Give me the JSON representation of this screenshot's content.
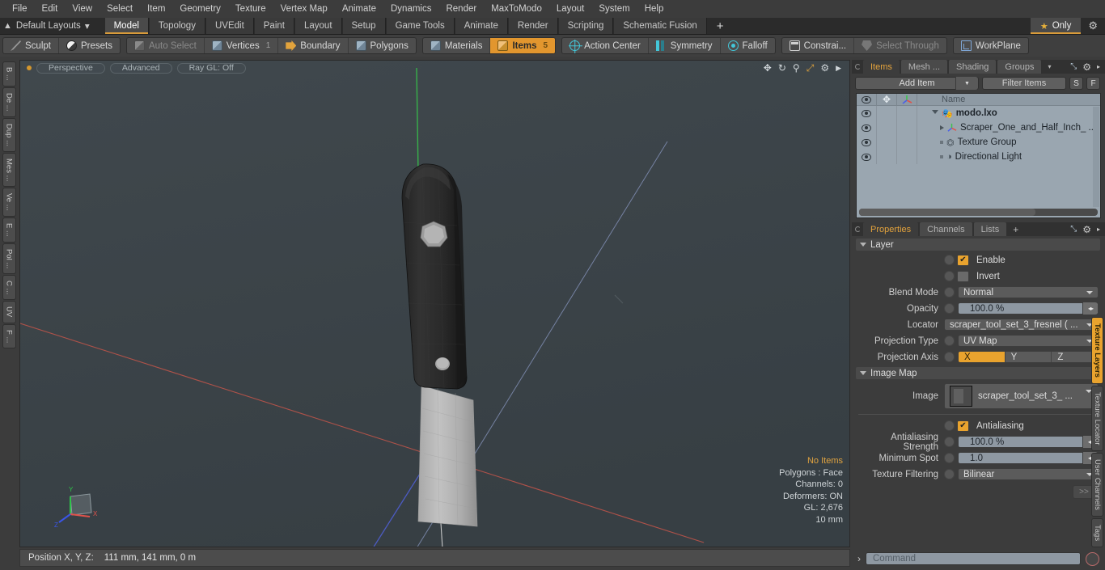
{
  "menu": {
    "items": [
      "File",
      "Edit",
      "View",
      "Select",
      "Item",
      "Geometry",
      "Texture",
      "Vertex Map",
      "Animate",
      "Dynamics",
      "Render",
      "MaxToModo",
      "Layout",
      "System",
      "Help"
    ]
  },
  "layout_bar": {
    "preset_label": "Default Layouts",
    "preset_caret": "▾",
    "tabs": [
      {
        "label": "Model",
        "active": true
      },
      {
        "label": "Topology",
        "active": false
      },
      {
        "label": "UVEdit",
        "active": false
      },
      {
        "label": "Paint",
        "active": false
      },
      {
        "label": "Layout",
        "active": false
      },
      {
        "label": "Setup",
        "active": false
      },
      {
        "label": "Game Tools",
        "active": false
      },
      {
        "label": "Animate",
        "active": false
      },
      {
        "label": "Render",
        "active": false
      },
      {
        "label": "Scripting",
        "active": false
      },
      {
        "label": "Schematic Fusion",
        "active": false
      }
    ],
    "add_tab": "+",
    "only_label": "Only",
    "star_icon": "★",
    "gear_icon": "⚙",
    "accent": "#d89b3a"
  },
  "toolbar": {
    "group1": [
      {
        "label": "Sculpt",
        "icon": "pencil-icon"
      },
      {
        "label": "Presets",
        "icon": "sphere-icon"
      }
    ],
    "group2": [
      {
        "label": "Auto Select",
        "icon": "cube-gray-icon",
        "count": "",
        "dim": true,
        "on": false
      },
      {
        "label": "Vertices",
        "icon": "cube-blue-icon",
        "count": "1",
        "dim": false,
        "on": false
      },
      {
        "label": "Boundary",
        "icon": "arrow-right-icon",
        "count": "",
        "dim": false,
        "on": false
      },
      {
        "label": "Polygons",
        "icon": "cube-blue-icon",
        "count": "",
        "dim": false,
        "on": false
      }
    ],
    "group3": [
      {
        "label": "Materials",
        "icon": "cube-blue-icon",
        "count": "",
        "dim": false,
        "on": false
      },
      {
        "label": "Items",
        "icon": "cube-orange-icon",
        "count": "5",
        "dim": false,
        "on": true
      }
    ],
    "group4": [
      {
        "label": "Action Center",
        "icon": "target-icon",
        "dim": false
      },
      {
        "label": "Symmetry",
        "icon": "symmetry-icon",
        "dim": false
      },
      {
        "label": "Falloff",
        "icon": "falloff-icon",
        "dim": false
      }
    ],
    "group5": [
      {
        "label": "Constrai...",
        "icon": "constraint-icon",
        "dim": false
      },
      {
        "label": "Select Through",
        "icon": "select-through-icon",
        "dim": true
      }
    ],
    "group6": [
      {
        "label": "WorkPlane",
        "icon": "workplane-icon",
        "dim": false
      }
    ]
  },
  "left_tabs": [
    "B ...",
    "De ...",
    "Dup ...",
    "Mes ...",
    "Ve ...",
    "E ...",
    "Pol ...",
    "C ...",
    "UV",
    "F ..."
  ],
  "viewport": {
    "mode": "Perspective",
    "shading": "Advanced",
    "raygl": "Ray GL: Off",
    "icons": [
      "move-icon",
      "rotate-icon",
      "magnifier-icon",
      "fit-icon",
      "gear-icon",
      "play-icon"
    ],
    "stats": {
      "selection": "No Items",
      "polygons": "Polygons : Face",
      "channels": "Channels: 0",
      "deformers": "Deformers: ON",
      "gl": "GL: 2,676",
      "grid": "10 mm"
    },
    "axis": {
      "x": "X",
      "y": "Y",
      "z": "Z"
    }
  },
  "statusbar": {
    "label": "Position X, Y, Z:",
    "value": "111 mm, 141 mm, 0 m"
  },
  "items_panel": {
    "tabs": [
      {
        "label": "Items",
        "active": true
      },
      {
        "label": "Mesh ...",
        "active": false
      },
      {
        "label": "Shading",
        "active": false
      },
      {
        "label": "Groups",
        "active": false
      }
    ],
    "tab_caret": "▾",
    "expand_icon": "⤡",
    "gear_icon": "⚙",
    "more_icon": "▸",
    "add_item_label": "Add Item",
    "filter_placeholder": "Filter Items",
    "s_button": "S",
    "f_button": "F",
    "columns": [
      "eye-icon",
      "move-icon",
      "axis-icon",
      "Name"
    ],
    "name_header": "Name",
    "rows": [
      {
        "name": "modo.lxo",
        "icon": "scene-icon",
        "indent": 0,
        "bold": true,
        "twirl": "down"
      },
      {
        "name": "Scraper_One_and_Half_Inch_ ...",
        "icon": "axis-icon",
        "indent": 1,
        "bold": false,
        "twirl": "right"
      },
      {
        "name": "Texture Group",
        "icon": "texture-group-icon",
        "indent": 1,
        "bold": false,
        "twirl": "none"
      },
      {
        "name": "Directional Light",
        "icon": "light-icon",
        "indent": 1,
        "bold": false,
        "twirl": "none"
      }
    ]
  },
  "properties_panel": {
    "tabs": [
      {
        "label": "Properties",
        "active": true
      },
      {
        "label": "Channels",
        "active": false
      },
      {
        "label": "Lists",
        "active": false
      }
    ],
    "add_tab": "+",
    "expand_icon": "⤡",
    "gear_icon": "⚙",
    "more_icon": "▸",
    "layer_section": "Layer",
    "enable": {
      "label": "Enable",
      "checked": true,
      "check_glyph": "✔"
    },
    "invert": {
      "label": "Invert",
      "checked": false
    },
    "blend_mode": {
      "label": "Blend Mode",
      "value": "Normal"
    },
    "opacity": {
      "label": "Opacity",
      "value": "100.0 %"
    },
    "locator": {
      "label": "Locator",
      "value": "scraper_tool_set_3_fresnel ( ..."
    },
    "projection_type": {
      "label": "Projection Type",
      "value": "UV Map"
    },
    "projection_axis": {
      "label": "Projection Axis",
      "options": [
        "X",
        "Y",
        "Z"
      ],
      "selected": "X"
    },
    "image_map_section": "Image Map",
    "image": {
      "label": "Image",
      "value": "scraper_tool_set_3_ ..."
    },
    "antialiasing": {
      "label": "Antialiasing",
      "checked": true,
      "check_glyph": "✔"
    },
    "aa_strength": {
      "label": "Antialiasing Strength",
      "value": "100.0 %"
    },
    "minimum_spot": {
      "label": "Minimum Spot",
      "value": "1.0"
    },
    "texture_filtering": {
      "label": "Texture Filtering",
      "value": "Bilinear"
    },
    "more_button": ">>"
  },
  "right_tabs": [
    {
      "label": "Texture Layers",
      "active": true
    },
    {
      "label": "Texture Locator",
      "active": false
    },
    {
      "label": "User Channels",
      "active": false
    },
    {
      "label": "Tags",
      "active": false
    }
  ],
  "command_bar": {
    "prompt": "›",
    "placeholder": "Command",
    "record_icon": "record-icon"
  }
}
